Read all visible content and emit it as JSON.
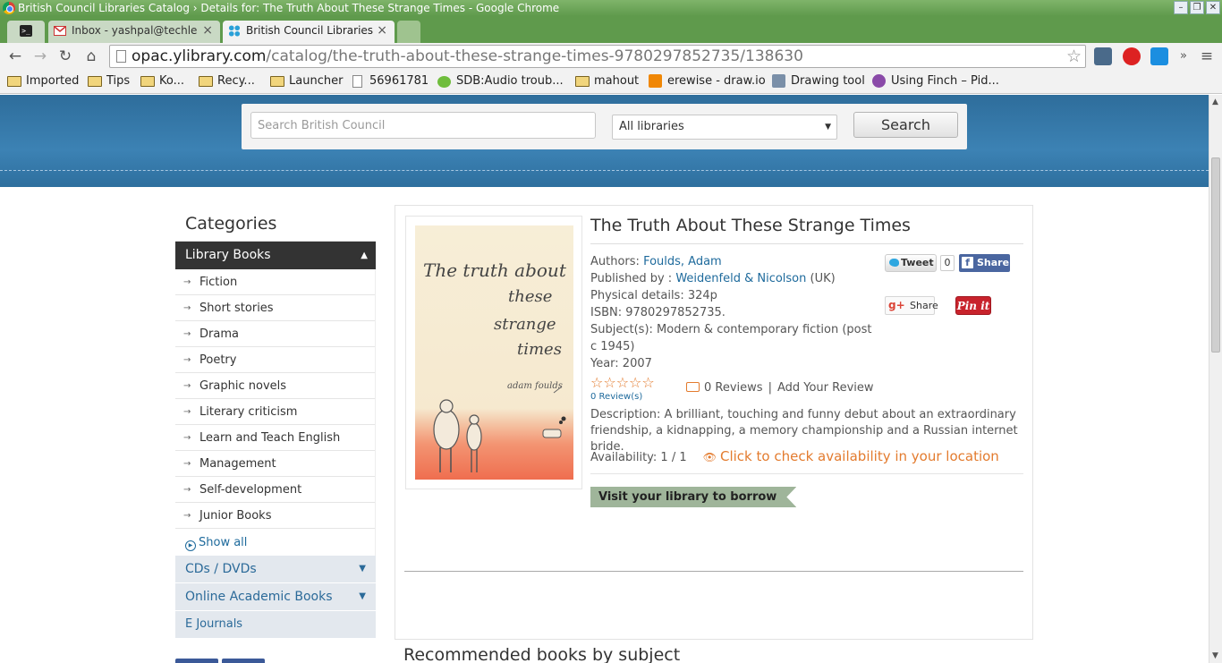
{
  "window": {
    "title": "British Council Libraries Catalog › Details for: The Truth About These Strange Times - Google Chrome",
    "controls": [
      "–",
      "❐",
      "✕"
    ]
  },
  "tabs": [
    {
      "label": ""
    },
    {
      "label": "Inbox - yashpal@techle"
    },
    {
      "label": "British Council Libraries"
    }
  ],
  "address": {
    "host": "opac.ylibrary.com",
    "path": "/catalog/the-truth-about-these-strange-times-9780297852735/138630"
  },
  "bookmarks": [
    {
      "label": "Imported",
      "icon": "folder"
    },
    {
      "label": "Tips",
      "icon": "folder"
    },
    {
      "label": "Ko...",
      "icon": "folder"
    },
    {
      "label": "Recy...",
      "icon": "folder"
    },
    {
      "label": "Launcher",
      "icon": "folder"
    },
    {
      "label": "56961781",
      "icon": "page"
    },
    {
      "label": "SDB:Audio troub...",
      "icon": "opensuse"
    },
    {
      "label": "mahout",
      "icon": "folder"
    },
    {
      "label": "erewise - draw.io",
      "icon": "drawio"
    },
    {
      "label": "Drawing tool",
      "icon": "drawing"
    },
    {
      "label": "Using Finch – Pid...",
      "icon": "pidgin"
    }
  ],
  "search": {
    "placeholder": "Search British Council",
    "library_select": "All libraries",
    "button": "Search"
  },
  "sidebar": {
    "title": "Categories",
    "active_group": "Library Books",
    "items": [
      "Fiction",
      "Short stories",
      "Drama",
      "Poetry",
      "Graphic novels",
      "Literary criticism",
      "Learn and Teach English",
      "Management",
      "Self-development",
      "Junior Books"
    ],
    "show_all": "Show all",
    "groups": [
      "CDs / DVDs",
      "Online Academic Books",
      "E Journals"
    ]
  },
  "book": {
    "title": "The Truth About These Strange Times",
    "authors_label": "Authors:",
    "author": "Foulds, Adam",
    "published_label": "Published by :",
    "publisher": "Weidenfeld & Nicolson",
    "publisher_country": "(UK)",
    "physical": "Physical details: 324p",
    "isbn": "ISBN: 9780297852735.",
    "subjects": "Subject(s): Modern & contemporary fiction (post c 1945)",
    "year": "Year: 2007",
    "stars": "☆☆☆☆☆",
    "reviews_small": "0 Review(s)",
    "reviews_count": "0 Reviews",
    "separator": "|",
    "add_review": "Add Your Review",
    "description": "Description: A brilliant, touching and funny debut about an extraordinary friendship, a kidnapping, a memory championship and a Russian internet bride.",
    "availability": "Availability: 1 / 1",
    "check_availability": "Click to check availability in your location",
    "visit_label": "Visit your library to borrow",
    "cover_text": [
      "The truth about",
      "these",
      "strange",
      "times",
      "adam foulds"
    ]
  },
  "social": {
    "tweet": "Tweet",
    "tweet_count": "0",
    "fb_share": "Share",
    "g_share": "Share",
    "pin": "Pin it"
  },
  "recommended_heading": "Recommended books by subject",
  "colors": {
    "hero_blue": "#3c82b4",
    "accent_orange": "#e37b2e",
    "link_blue": "#1e6a9c",
    "sidebar_dark": "#333333"
  }
}
